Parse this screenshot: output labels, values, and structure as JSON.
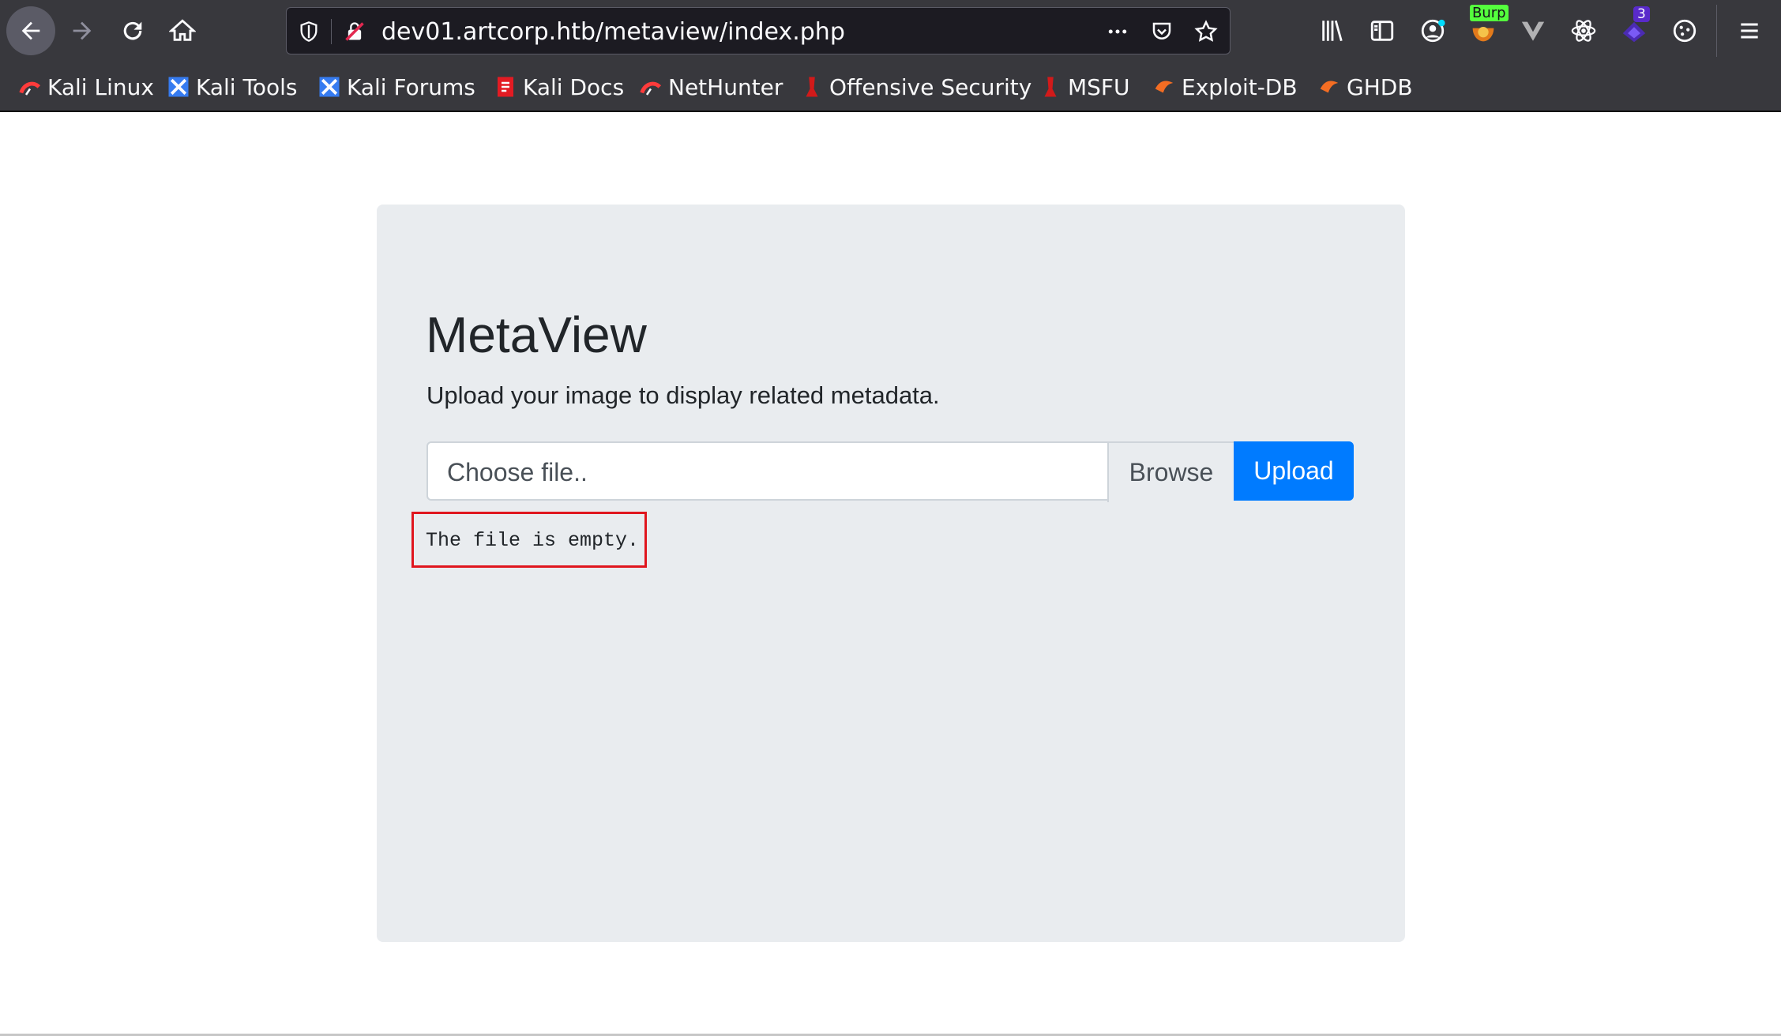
{
  "browser": {
    "url": "dev01.artcorp.htb/metaview/index.php",
    "burp_badge": "Burp",
    "extension_count": "3"
  },
  "bookmarks": [
    {
      "label": "Kali Linux",
      "icon": "kali-icon"
    },
    {
      "label": "Kali Tools",
      "icon": "kali-tools-icon"
    },
    {
      "label": "Kali Forums",
      "icon": "kali-forums-icon"
    },
    {
      "label": "Kali Docs",
      "icon": "kali-docs-icon"
    },
    {
      "label": "NetHunter",
      "icon": "nethunter-icon"
    },
    {
      "label": "Offensive Security",
      "icon": "offsec-icon"
    },
    {
      "label": "MSFU",
      "icon": "msfu-icon"
    },
    {
      "label": "Exploit-DB",
      "icon": "exploitdb-icon"
    },
    {
      "label": "GHDB",
      "icon": "ghdb-icon"
    }
  ],
  "page": {
    "title": "MetaView",
    "lead": "Upload your image to display related metadata.",
    "file_placeholder": "Choose file..",
    "browse_label": "Browse",
    "upload_label": "Upload",
    "message": "The file is empty."
  },
  "colors": {
    "accent": "#007bff",
    "error_border": "#e0161e",
    "panel_bg": "#e9ecef",
    "chrome_bg": "#38383d"
  }
}
